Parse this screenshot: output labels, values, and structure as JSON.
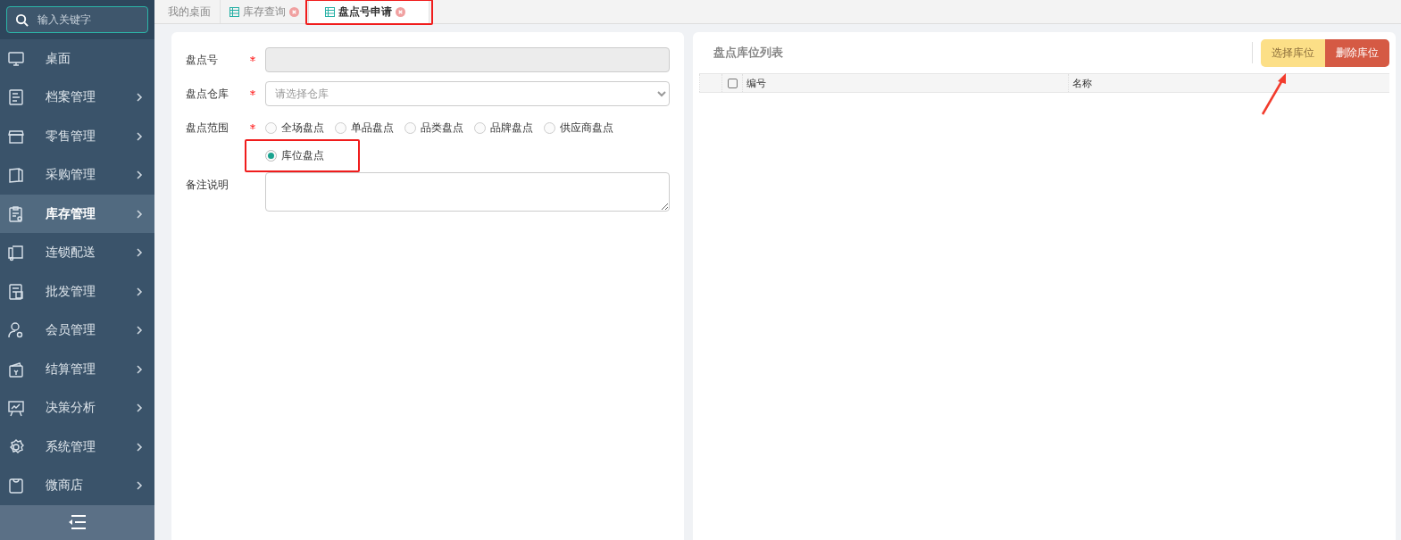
{
  "sidebar": {
    "search": {
      "placeholder": "输入关键字"
    },
    "items": [
      {
        "label": "桌面",
        "has_arrow": false,
        "selected": false
      },
      {
        "label": "档案管理",
        "has_arrow": true,
        "selected": false
      },
      {
        "label": "零售管理",
        "has_arrow": true,
        "selected": false
      },
      {
        "label": "采购管理",
        "has_arrow": true,
        "selected": false
      },
      {
        "label": "库存管理",
        "has_arrow": true,
        "selected": true
      },
      {
        "label": "连锁配送",
        "has_arrow": true,
        "selected": false
      },
      {
        "label": "批发管理",
        "has_arrow": true,
        "selected": false
      },
      {
        "label": "会员管理",
        "has_arrow": true,
        "selected": false
      },
      {
        "label": "结算管理",
        "has_arrow": true,
        "selected": false
      },
      {
        "label": "决策分析",
        "has_arrow": true,
        "selected": false
      },
      {
        "label": "系统管理",
        "has_arrow": true,
        "selected": false
      },
      {
        "label": "微商店",
        "has_arrow": true,
        "selected": false
      }
    ]
  },
  "tabs": [
    {
      "label": "我的桌面",
      "closable": false,
      "selected": false,
      "highlighted": false
    },
    {
      "label": "库存查询",
      "closable": true,
      "selected": false,
      "highlighted": false
    },
    {
      "label": "盘点号申请",
      "closable": true,
      "selected": true,
      "highlighted": true
    }
  ],
  "form": {
    "fields": [
      {
        "kind": "text",
        "label": "盘点号",
        "required": true,
        "disabled": true
      },
      {
        "kind": "select",
        "label": "盘点仓库",
        "required": true,
        "placeholder": "请选择仓库"
      },
      {
        "kind": "radio",
        "label": "盘点范围",
        "required": true,
        "options": [
          {
            "label": "全场盘点",
            "selected": false,
            "highlighted": false
          },
          {
            "label": "单品盘点",
            "selected": false,
            "highlighted": false
          },
          {
            "label": "品类盘点",
            "selected": false,
            "highlighted": false
          },
          {
            "label": "品牌盘点",
            "selected": false,
            "highlighted": false
          },
          {
            "label": "供应商盘点",
            "selected": false,
            "highlighted": false
          },
          {
            "label": "库位盘点",
            "selected": true,
            "highlighted": true
          }
        ]
      },
      {
        "kind": "textarea",
        "label": "备注说明",
        "required": false
      }
    ]
  },
  "list_panel": {
    "title": "盘点库位列表",
    "buttons": [
      {
        "label": "选择库位",
        "kind": "warning",
        "highlighted": true
      },
      {
        "label": "删除库位",
        "kind": "danger",
        "highlighted": false
      }
    ],
    "table": {
      "select_all_checked": false,
      "columns": [
        "编号",
        "名称"
      ]
    }
  }
}
